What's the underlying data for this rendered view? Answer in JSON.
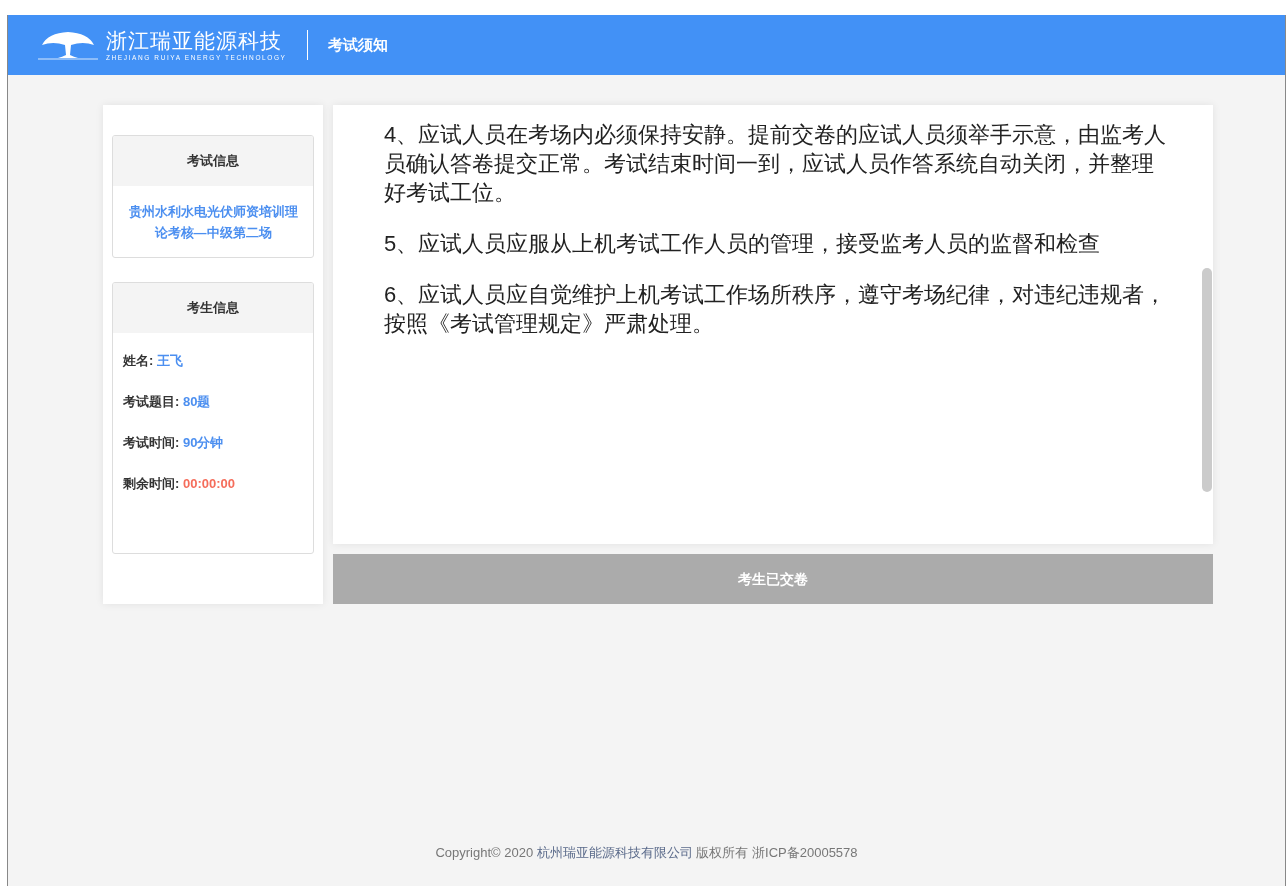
{
  "header": {
    "company_name": "浙江瑞亚能源科技",
    "company_subtitle": "ZHEJIANG RUIYA ENERGY TECHNOLOGY",
    "page_title": "考试须知"
  },
  "exam_info": {
    "title": "考试信息",
    "exam_name": "贵州水利水电光伏师资培训理论考核—中级第二场"
  },
  "candidate_info": {
    "title": "考生信息",
    "fields": [
      {
        "label": "姓名:",
        "value": "王飞",
        "kind": "normal"
      },
      {
        "label": "考试题目:",
        "value": "80题",
        "kind": "normal"
      },
      {
        "label": "考试时间:",
        "value": "90分钟",
        "kind": "normal"
      },
      {
        "label": "剩余时间:",
        "value": "00:00:00",
        "kind": "alert"
      }
    ]
  },
  "notice": {
    "paragraphs": [
      "4、应试人员在考场内必须保持安静。提前交卷的应试人员须举手示意，由监考人员确认答卷提交正常。考试结束时间一到，应试人员作答系统自动关闭，并整理好考试工位。",
      "5、应试人员应服从上机考试工作人员的管理，接受监考人员的监督和检查",
      "6、应试人员应自觉维护上机考试工作场所秩序，遵守考场纪律，对违纪违规者，按照《考试管理规定》严肃处理。"
    ]
  },
  "submit_button": {
    "label": "考生已交卷",
    "disabled": true
  },
  "footer": {
    "prefix": "Copyright© 2020",
    "company": "杭州瑞亚能源科技有限公司",
    "suffix": "版权所有 浙ICP备20005578"
  }
}
